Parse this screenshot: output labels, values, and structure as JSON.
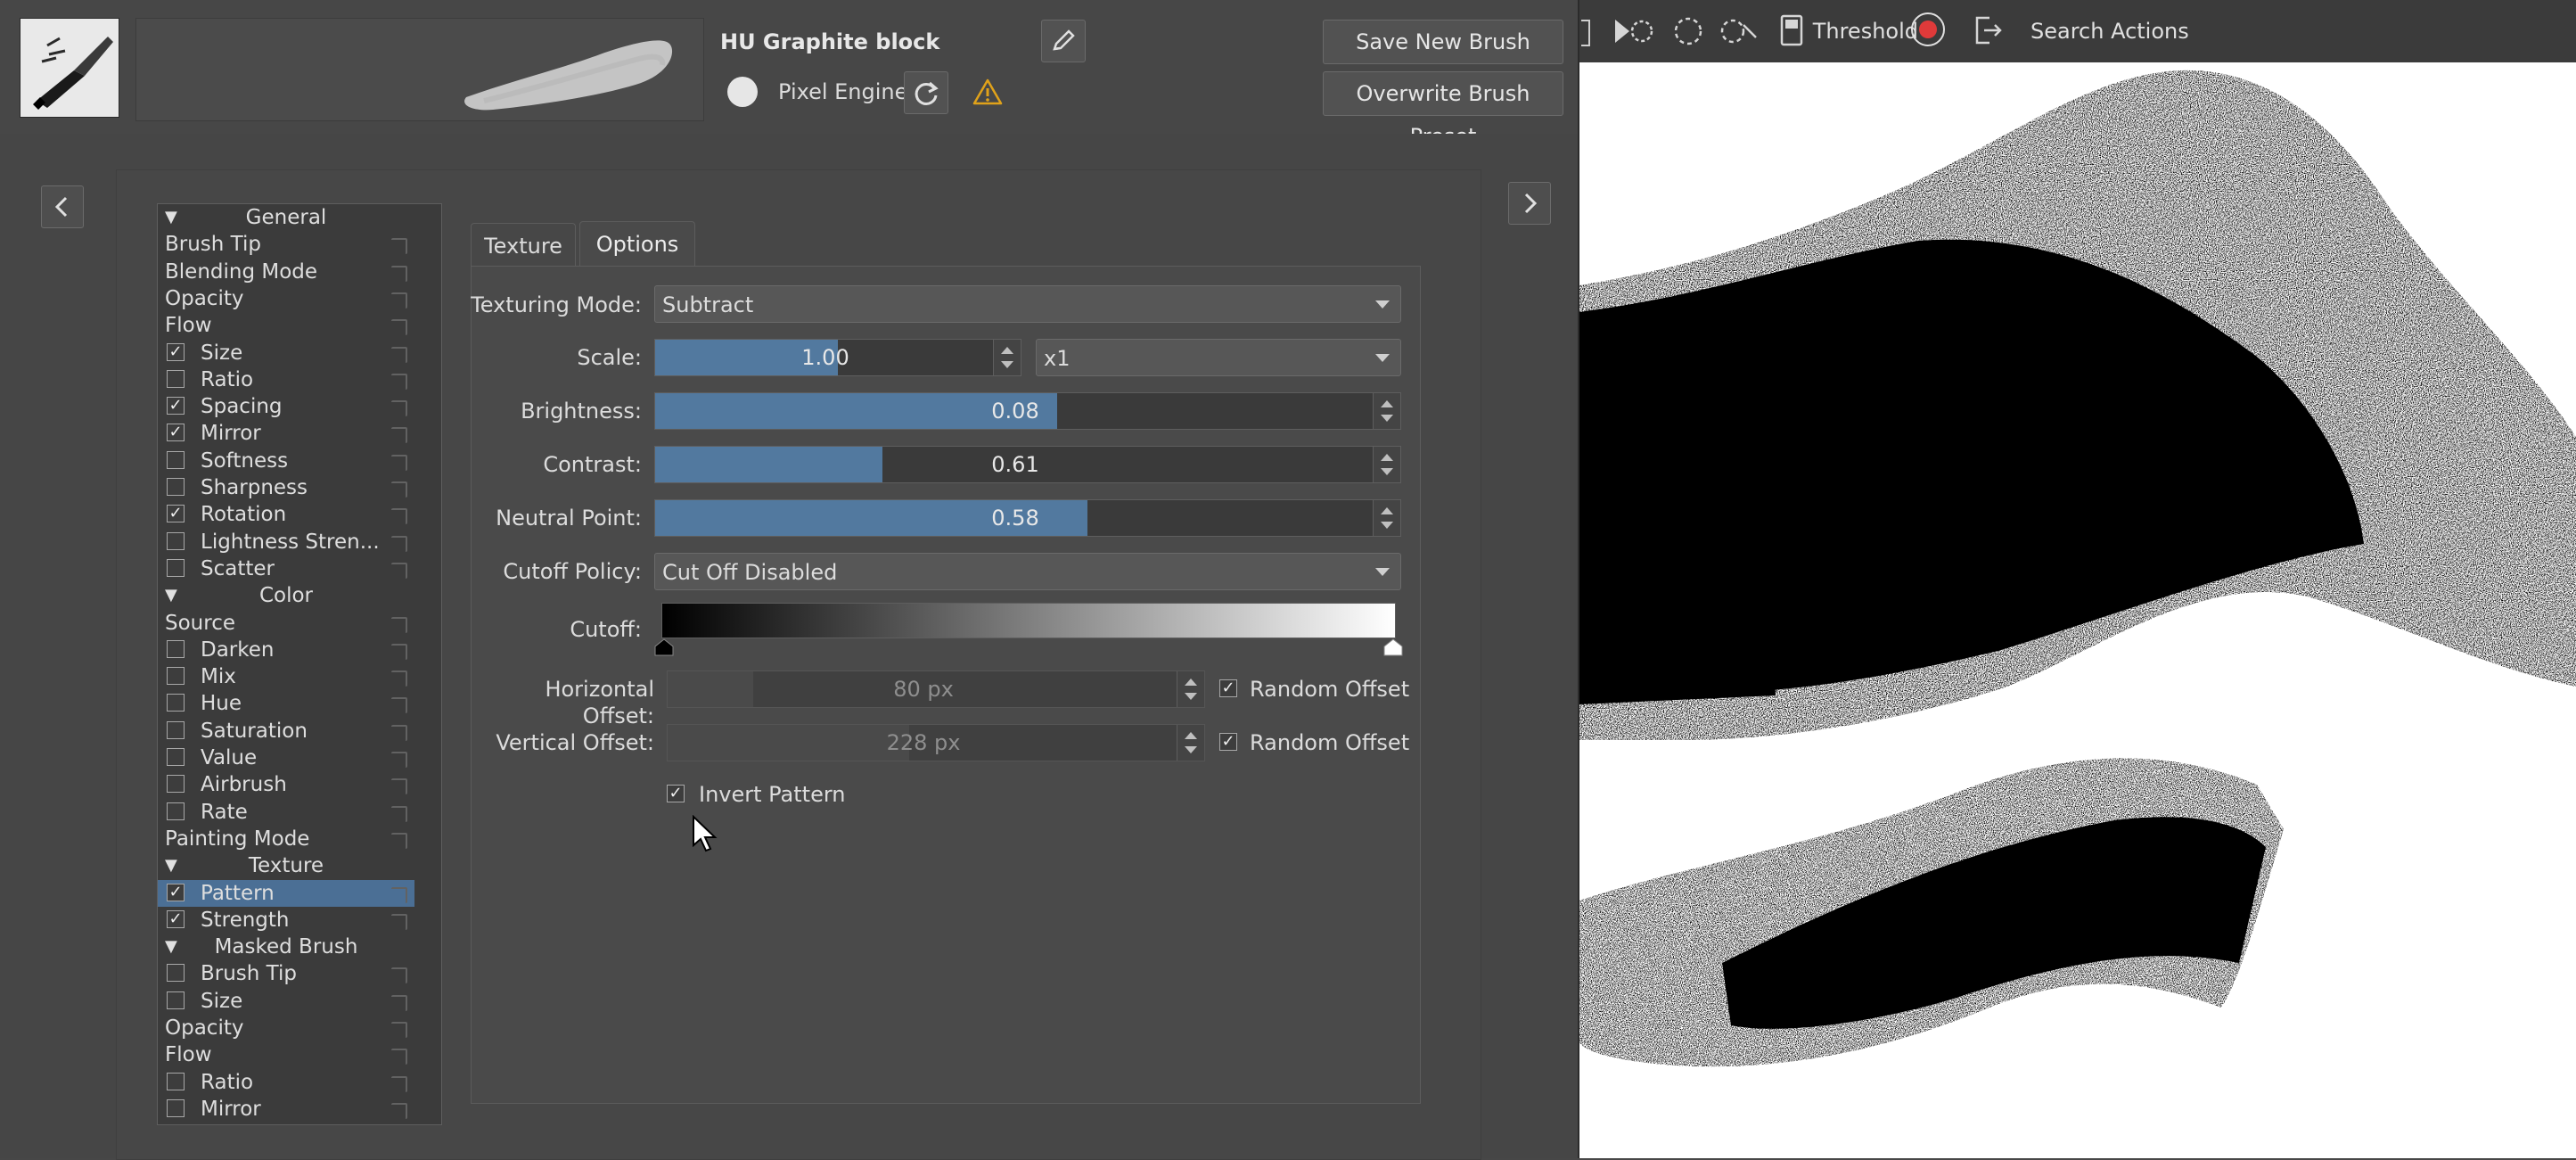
{
  "header": {
    "preset_name": "HU Graphite block",
    "engine_label": "Pixel Engine",
    "save_new_label": "Save New Brush Preset...",
    "overwrite_label": "Overwrite Brush Preset"
  },
  "option_list": {
    "items": [
      {
        "type": "header",
        "label": "General"
      },
      {
        "type": "plain",
        "label": "Brush Tip"
      },
      {
        "type": "plain",
        "label": "Blending Mode"
      },
      {
        "type": "plain",
        "label": "Opacity"
      },
      {
        "type": "plain",
        "label": "Flow"
      },
      {
        "type": "check",
        "label": "Size",
        "checked": true
      },
      {
        "type": "check",
        "label": "Ratio",
        "checked": false
      },
      {
        "type": "check",
        "label": "Spacing",
        "checked": true
      },
      {
        "type": "check",
        "label": "Mirror",
        "checked": true
      },
      {
        "type": "check",
        "label": "Softness",
        "checked": false
      },
      {
        "type": "check",
        "label": "Sharpness",
        "checked": false
      },
      {
        "type": "check",
        "label": "Rotation",
        "checked": true
      },
      {
        "type": "check",
        "label": "Lightness Stren...",
        "checked": false
      },
      {
        "type": "check",
        "label": "Scatter",
        "checked": false
      },
      {
        "type": "header",
        "label": "Color"
      },
      {
        "type": "plain",
        "label": "Source"
      },
      {
        "type": "check",
        "label": "Darken",
        "checked": false
      },
      {
        "type": "check",
        "label": "Mix",
        "checked": false
      },
      {
        "type": "check",
        "label": "Hue",
        "checked": false
      },
      {
        "type": "check",
        "label": "Saturation",
        "checked": false
      },
      {
        "type": "check",
        "label": "Value",
        "checked": false
      },
      {
        "type": "check",
        "label": "Airbrush",
        "checked": false
      },
      {
        "type": "check",
        "label": "Rate",
        "checked": false
      },
      {
        "type": "plain",
        "label": "Painting Mode"
      },
      {
        "type": "header",
        "label": "Texture"
      },
      {
        "type": "check",
        "label": "Pattern",
        "checked": true,
        "selected": true
      },
      {
        "type": "check",
        "label": "Strength",
        "checked": true
      },
      {
        "type": "header",
        "label": "Masked Brush"
      },
      {
        "type": "check",
        "label": "Brush Tip",
        "checked": false
      },
      {
        "type": "check",
        "label": "Size",
        "checked": false
      },
      {
        "type": "plain",
        "label": "Opacity"
      },
      {
        "type": "plain",
        "label": "Flow"
      },
      {
        "type": "check",
        "label": "Ratio",
        "checked": false
      },
      {
        "type": "check",
        "label": "Mirror",
        "checked": false
      }
    ]
  },
  "tabs": [
    {
      "label": "Texture",
      "active": false
    },
    {
      "label": "Options",
      "active": true
    }
  ],
  "options": {
    "texturing_mode": {
      "label": "Texturing Mode:",
      "value": "Subtract"
    },
    "scale": {
      "label": "Scale:",
      "value": "1.00",
      "fraction": 0.5,
      "multiplier": "x1"
    },
    "brightness": {
      "label": "Brightness:",
      "value": "0.08",
      "fraction": 0.54
    },
    "contrast": {
      "label": "Contrast:",
      "value": "0.61",
      "fraction": 0.305
    },
    "neutral_point": {
      "label": "Neutral Point:",
      "value": "0.58",
      "fraction": 0.58
    },
    "cutoff_policy": {
      "label": "Cutoff Policy:",
      "value": "Cut Off Disabled"
    },
    "cutoff": {
      "label": "Cutoff:"
    },
    "horizontal_offset": {
      "label": "Horizontal Offset:",
      "value": "80 px",
      "random_label": "Random Offset",
      "random_checked": true,
      "fraction": 0.16
    },
    "vertical_offset": {
      "label": "Vertical Offset:",
      "value": "228 px",
      "random_label": "Random Offset",
      "random_checked": true,
      "fraction": 0.45
    },
    "invert_pattern": {
      "label": "Invert Pattern",
      "checked": true
    }
  },
  "toolbar": {
    "threshold_label": "Threshold",
    "search_label": "Search Actions"
  },
  "colors": {
    "accent": "#52799f",
    "selection": "#4b6f95",
    "record": "#e03a3a",
    "warning": "#e0a21a"
  }
}
